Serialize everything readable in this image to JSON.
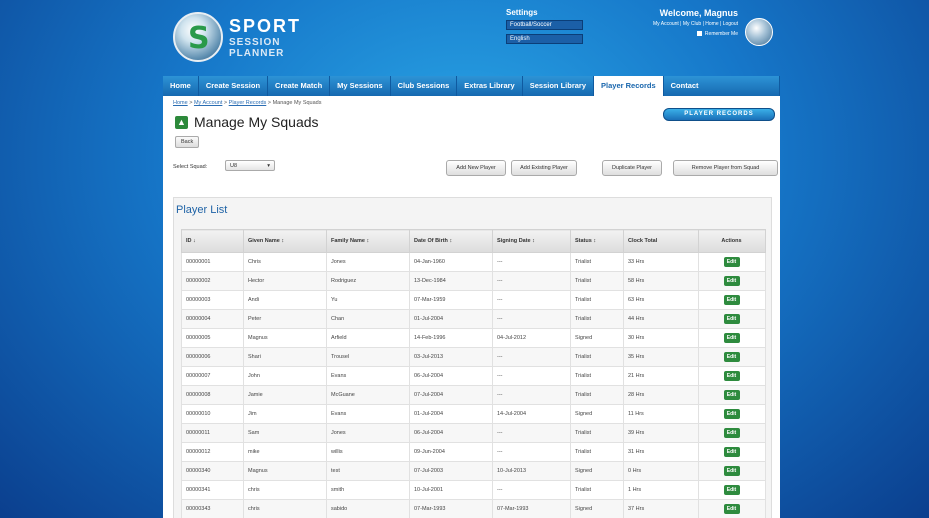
{
  "branding": {
    "line1": "SPORT",
    "line2": "SESSION",
    "line3": "PLANNER"
  },
  "settings": {
    "label": "Settings",
    "sport_select": "Football/Soccer",
    "language_select": "English"
  },
  "welcome": {
    "greeting": "Welcome, Magnus",
    "links": "My Account | My Club | Home | Logout",
    "remember": "Remember Me"
  },
  "nav": {
    "items": [
      "Home",
      "Create Session",
      "Create Match",
      "My Sessions",
      "Club Sessions",
      "Extras Library",
      "Session Library",
      "Player Records",
      "Contact"
    ],
    "active": "Player Records"
  },
  "breadcrumb": {
    "home": "Home",
    "account": "My Account",
    "records": "Player Records",
    "current": "Manage My Squads"
  },
  "brand_button": "PLAYER RECORDS",
  "page_title": "Manage My Squads",
  "back_label": "Back",
  "squad": {
    "label": "Select Squad:",
    "value": "U8"
  },
  "actions": {
    "add_new": "Add New Player",
    "add_existing": "Add Existing Player",
    "duplicate": "Duplicate Player",
    "remove": "Remove Player from Squad"
  },
  "player_list": {
    "title": "Player List",
    "columns": [
      "ID",
      "Given Name",
      "Family Name",
      "Date Of Birth",
      "Signing Date",
      "Status",
      "Clock Total",
      "Actions"
    ],
    "edit_label": "Edit",
    "rows": [
      [
        "00000001",
        "Chris",
        "Jones",
        "04-Jan-1960",
        "---",
        "Trialist",
        "33 Hrs"
      ],
      [
        "00000002",
        "Hector",
        "Rodriguez",
        "13-Dec-1984",
        "---",
        "Trialist",
        "58 Hrs"
      ],
      [
        "00000003",
        "Andi",
        "Yu",
        "07-Mar-1959",
        "---",
        "Trialist",
        "63 Hrs"
      ],
      [
        "00000004",
        "Peter",
        "Chan",
        "01-Jul-2004",
        "---",
        "Trialist",
        "44 Hrs"
      ],
      [
        "00000005",
        "Magnus",
        "Arfield",
        "14-Feb-1996",
        "04-Jul-2012",
        "Signed",
        "30 Hrs"
      ],
      [
        "00000006",
        "Shari",
        "Trousel",
        "03-Jul-2013",
        "---",
        "Trialist",
        "35 Hrs"
      ],
      [
        "00000007",
        "John",
        "Evans",
        "06-Jul-2004",
        "---",
        "Trialist",
        "21 Hrs"
      ],
      [
        "00000008",
        "Jamie",
        "McGuane",
        "07-Jul-2004",
        "---",
        "Trialist",
        "28 Hrs"
      ],
      [
        "00000010",
        "Jim",
        "Evans",
        "01-Jul-2004",
        "14-Jul-2004",
        "Signed",
        "11 Hrs"
      ],
      [
        "00000011",
        "Sam",
        "Jones",
        "06-Jul-2004",
        "---",
        "Trialist",
        "39 Hrs"
      ],
      [
        "00000012",
        "mike",
        "willis",
        "09-Jun-2004",
        "---",
        "Trialist",
        "31 Hrs"
      ],
      [
        "00000340",
        "Magnus",
        "test",
        "07-Jul-2003",
        "10-Jul-2013",
        "Signed",
        "0 Hrs"
      ],
      [
        "00000341",
        "chris",
        "smith",
        "10-Jul-2001",
        "---",
        "Trialist",
        "1 Hrs"
      ],
      [
        "00000343",
        "chris",
        "sabido",
        "07-Mar-1993",
        "07-Mar-1993",
        "Signed",
        "37 Hrs"
      ]
    ]
  }
}
